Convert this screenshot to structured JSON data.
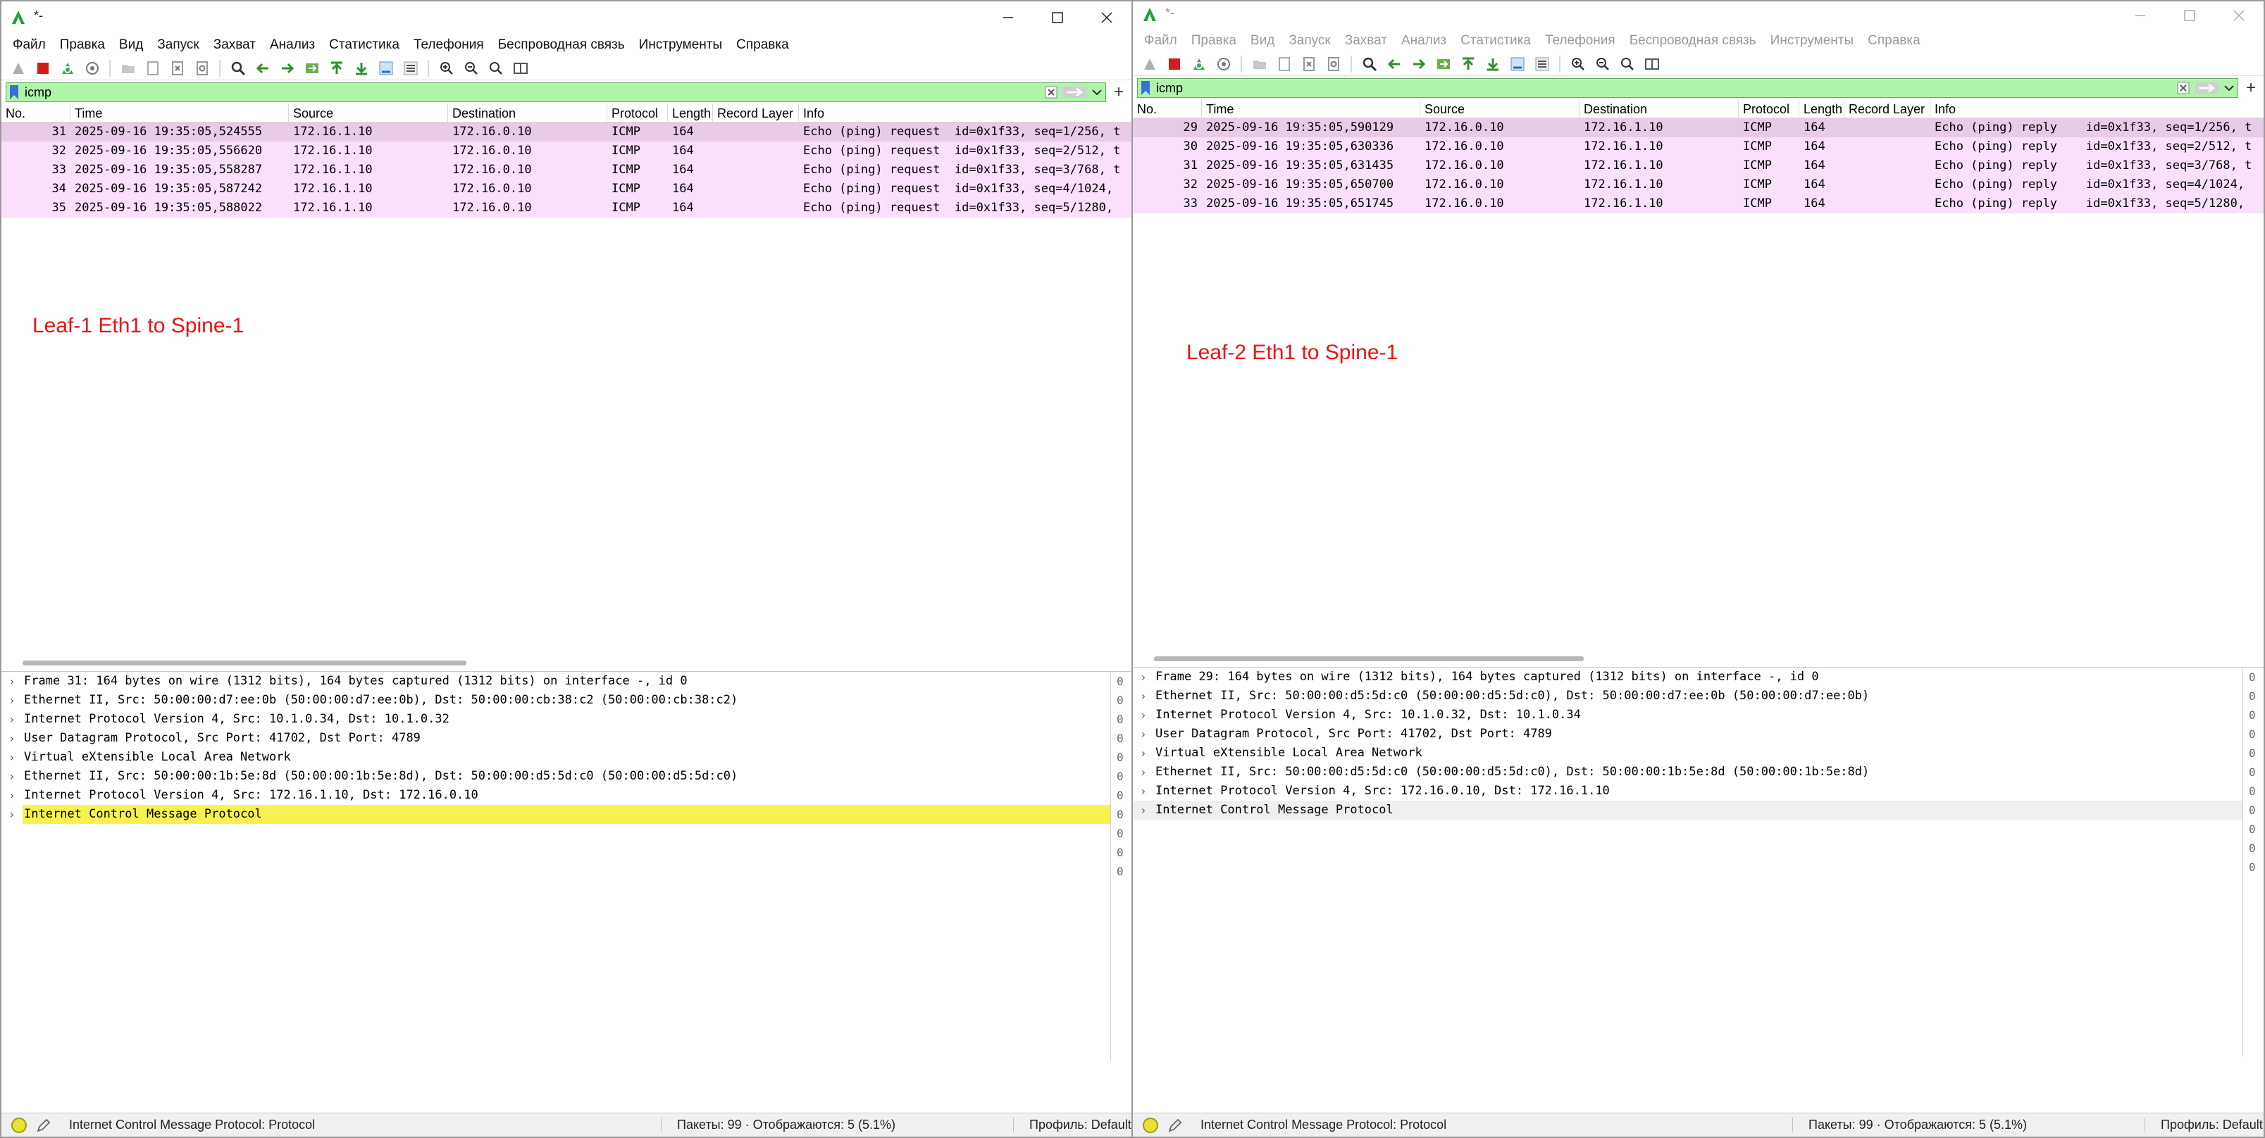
{
  "windows": [
    {
      "title": "*-",
      "menu": [
        "Файл",
        "Правка",
        "Вид",
        "Запуск",
        "Захват",
        "Анализ",
        "Статистика",
        "Телефония",
        "Беспроводная связь",
        "Инструменты",
        "Справка"
      ],
      "filter": {
        "value": "icmp"
      },
      "columns": [
        "No.",
        "Time",
        "Source",
        "Destination",
        "Protocol",
        "Length",
        "Record Layer",
        "Info"
      ],
      "packets": [
        {
          "no": "31",
          "time": "2025-09-16 19:35:05,524555",
          "source": "172.16.1.10",
          "destination": "172.16.0.10",
          "protocol": "ICMP",
          "length": "164",
          "record": "",
          "info": "Echo (ping) request  id=0x1f33, seq=1/256, t"
        },
        {
          "no": "32",
          "time": "2025-09-16 19:35:05,556620",
          "source": "172.16.1.10",
          "destination": "172.16.0.10",
          "protocol": "ICMP",
          "length": "164",
          "record": "",
          "info": "Echo (ping) request  id=0x1f33, seq=2/512, t"
        },
        {
          "no": "33",
          "time": "2025-09-16 19:35:05,558287",
          "source": "172.16.1.10",
          "destination": "172.16.0.10",
          "protocol": "ICMP",
          "length": "164",
          "record": "",
          "info": "Echo (ping) request  id=0x1f33, seq=3/768, t"
        },
        {
          "no": "34",
          "time": "2025-09-16 19:35:05,587242",
          "source": "172.16.1.10",
          "destination": "172.16.0.10",
          "protocol": "ICMP",
          "length": "164",
          "record": "",
          "info": "Echo (ping) request  id=0x1f33, seq=4/1024,"
        },
        {
          "no": "35",
          "time": "2025-09-16 19:35:05,588022",
          "source": "172.16.1.10",
          "destination": "172.16.0.10",
          "protocol": "ICMP",
          "length": "164",
          "record": "",
          "info": "Echo (ping) request  id=0x1f33, seq=5/1280,"
        }
      ],
      "annotation": "Leaf-1 Eth1 to Spine-1",
      "details": [
        "Frame 31: 164 bytes on wire (1312 bits), 164 bytes captured (1312 bits) on interface -, id 0",
        "Ethernet II, Src: 50:00:00:d7:ee:0b (50:00:00:d7:ee:0b), Dst: 50:00:00:cb:38:c2 (50:00:00:cb:38:c2)",
        "Internet Protocol Version 4, Src: 10.1.0.34, Dst: 10.1.0.32",
        "User Datagram Protocol, Src Port: 41702, Dst Port: 4789",
        "Virtual eXtensible Local Area Network",
        "Ethernet II, Src: 50:00:00:1b:5e:8d (50:00:00:1b:5e:8d), Dst: 50:00:00:d5:5d:c0 (50:00:00:d5:5d:c0)",
        "Internet Protocol Version 4, Src: 172.16.1.10, Dst: 172.16.0.10",
        "Internet Control Message Protocol"
      ],
      "bytes_digits": [
        "0",
        "0",
        "0",
        "0",
        "0",
        "0",
        "0",
        "0",
        "0",
        "0",
        "0"
      ],
      "status": {
        "text": "Internet Control Message Protocol: Protocol",
        "packets": "Пакеты: 99 · Отображаются: 5 (5.1%)",
        "profile": "Профиль: Default"
      }
    },
    {
      "title": "*-",
      "menu": [
        "Файл",
        "Правка",
        "Вид",
        "Запуск",
        "Захват",
        "Анализ",
        "Статистика",
        "Телефония",
        "Беспроводная связь",
        "Инструменты",
        "Справка"
      ],
      "filter": {
        "value": "icmp"
      },
      "columns": [
        "No.",
        "Time",
        "Source",
        "Destination",
        "Protocol",
        "Length",
        "Record Layer",
        "Info"
      ],
      "packets": [
        {
          "no": "29",
          "time": "2025-09-16 19:35:05,590129",
          "source": "172.16.0.10",
          "destination": "172.16.1.10",
          "protocol": "ICMP",
          "length": "164",
          "record": "",
          "info": "Echo (ping) reply    id=0x1f33, seq=1/256, t"
        },
        {
          "no": "30",
          "time": "2025-09-16 19:35:05,630336",
          "source": "172.16.0.10",
          "destination": "172.16.1.10",
          "protocol": "ICMP",
          "length": "164",
          "record": "",
          "info": "Echo (ping) reply    id=0x1f33, seq=2/512, t"
        },
        {
          "no": "31",
          "time": "2025-09-16 19:35:05,631435",
          "source": "172.16.0.10",
          "destination": "172.16.1.10",
          "protocol": "ICMP",
          "length": "164",
          "record": "",
          "info": "Echo (ping) reply    id=0x1f33, seq=3/768, t"
        },
        {
          "no": "32",
          "time": "2025-09-16 19:35:05,650700",
          "source": "172.16.0.10",
          "destination": "172.16.1.10",
          "protocol": "ICMP",
          "length": "164",
          "record": "",
          "info": "Echo (ping) reply    id=0x1f33, seq=4/1024,"
        },
        {
          "no": "33",
          "time": "2025-09-16 19:35:05,651745",
          "source": "172.16.0.10",
          "destination": "172.16.1.10",
          "protocol": "ICMP",
          "length": "164",
          "record": "",
          "info": "Echo (ping) reply    id=0x1f33, seq=5/1280,"
        }
      ],
      "annotation": "Leaf-2 Eth1 to Spine-1",
      "details": [
        "Frame 29: 164 bytes on wire (1312 bits), 164 bytes captured (1312 bits) on interface -, id 0",
        "Ethernet II, Src: 50:00:00:d5:5d:c0 (50:00:00:d5:5d:c0), Dst: 50:00:00:d7:ee:0b (50:00:00:d7:ee:0b)",
        "Internet Protocol Version 4, Src: 10.1.0.32, Dst: 10.1.0.34",
        "User Datagram Protocol, Src Port: 41702, Dst Port: 4789",
        "Virtual eXtensible Local Area Network",
        "Ethernet II, Src: 50:00:00:d5:5d:c0 (50:00:00:d5:5d:c0), Dst: 50:00:00:1b:5e:8d (50:00:00:1b:5e:8d)",
        "Internet Protocol Version 4, Src: 172.16.0.10, Dst: 172.16.1.10",
        "Internet Control Message Protocol"
      ],
      "bytes_digits": [
        "0",
        "0",
        "0",
        "0",
        "0",
        "0",
        "0",
        "0",
        "0",
        "0",
        "0"
      ],
      "status": {
        "text": "Internet Control Message Protocol: Protocol",
        "packets": "Пакеты: 99 · Отображаются: 5 (5.1%)",
        "profile": "Профиль: Default"
      }
    }
  ],
  "colors": {
    "row_bg": "#fbe0fb",
    "row_selected": "#e7cbe7",
    "filter_bg": "#aff5a9",
    "highlight": "#f7f250",
    "annotation": "#ee1111"
  },
  "icons": [
    "shark-fin-icon",
    "stop-capture-icon",
    "restart-capture-icon",
    "capture-options-icon",
    "open-file-icon",
    "save-file-icon",
    "close-file-icon",
    "reload-file-icon",
    "find-packet-icon",
    "go-back-icon",
    "go-forward-icon",
    "go-to-packet-icon",
    "first-packet-icon",
    "last-packet-icon",
    "autoscroll-icon",
    "colorize-icon",
    "zoom-in-icon",
    "zoom-out-icon",
    "normal-size-icon",
    "resize-columns-icon"
  ]
}
